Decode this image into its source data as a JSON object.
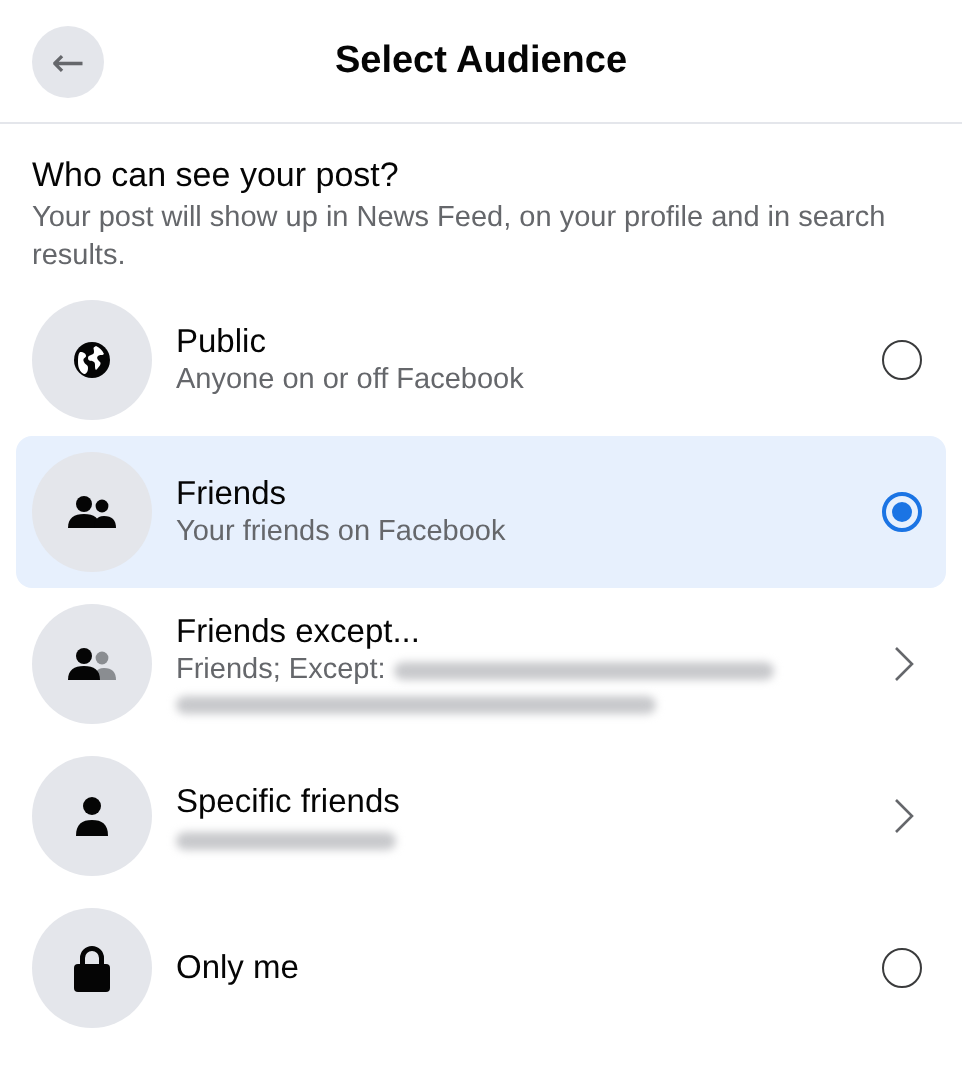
{
  "header": {
    "back_icon": "←",
    "title": "Select Audience"
  },
  "heading": "Who can see your post?",
  "description": "Your post will show up in News Feed, on your profile and in search results.",
  "options": [
    {
      "kind": "radio",
      "title": "Public",
      "subtitle": "Anyone on or off Facebook",
      "selected": false
    },
    {
      "kind": "radio",
      "title": "Friends",
      "subtitle": "Your friends on Facebook",
      "selected": true
    },
    {
      "kind": "submenu",
      "title": "Friends except...",
      "subtitle": "Friends; Except:"
    },
    {
      "kind": "submenu",
      "title": "Specific friends"
    },
    {
      "kind": "radio",
      "title": "Only me",
      "selected": false
    }
  ]
}
